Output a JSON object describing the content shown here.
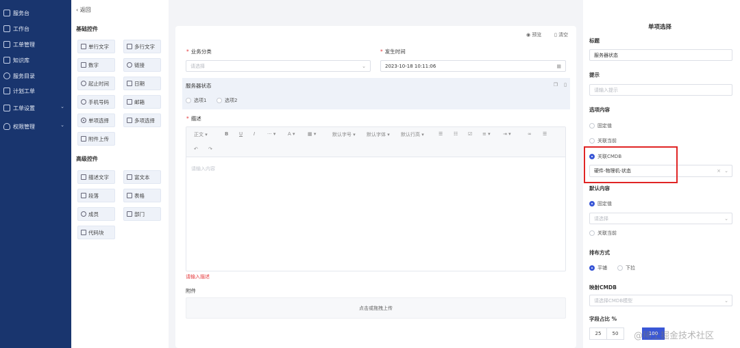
{
  "nav": {
    "items": [
      {
        "label": "服务台"
      },
      {
        "label": "工作台"
      },
      {
        "label": "工单管理"
      },
      {
        "label": "知识库"
      },
      {
        "label": "服务目录"
      },
      {
        "label": "计划工单"
      },
      {
        "label": "工单设置"
      },
      {
        "label": "权限管理"
      }
    ]
  },
  "left": {
    "back": "返回",
    "basic_title": "基础控件",
    "basic": [
      "单行文字",
      "多行文字",
      "数字",
      "链接",
      "起止时间",
      "日期",
      "手机号码",
      "邮箱",
      "单项选择",
      "多项选择",
      "附件上传"
    ],
    "adv_title": "高级控件",
    "adv": [
      "描述文字",
      "富文本",
      "段落",
      "表格",
      "成员",
      "部门",
      "代码块"
    ]
  },
  "canvas": {
    "preview": "预览",
    "clear": "清空",
    "cat_label": "业务分类",
    "cat_placeholder": "请选择",
    "time_label": "发生时间",
    "time_value": "2023-10-18 10:11:06",
    "server_label": "服务器状态",
    "opt1": "选项1",
    "opt2": "选项2",
    "desc_label": "描述",
    "toolbar": {
      "text": "正文",
      "font_size": "默认字号",
      "font_family": "默认字体",
      "line_height": "默认行高"
    },
    "editor_placeholder": "请输入内容",
    "error": "请输入描述",
    "attach_label": "附件",
    "upload": "点击或拖拽上传"
  },
  "right": {
    "title": "单项选择",
    "f_title": "标题",
    "f_title_value": "服务器状态",
    "f_hint": "提示",
    "f_hint_placeholder": "请输入提示",
    "opt_content": "选项内容",
    "opt_fixed": "固定值",
    "opt_current": "关联当前",
    "opt_cmdb": "关联CMDB",
    "cmdb_value": "硬件-物理机-状态",
    "default_title": "默认内容",
    "def_fixed": "固定值",
    "def_placeholder": "请选择",
    "def_current": "关联当前",
    "layout_title": "排布方式",
    "layout_h": "平铺",
    "layout_v": "下拉",
    "map_title": "映射CMDB",
    "map_placeholder": "请选择CMDB模型",
    "ratio_title": "字段占比 %",
    "ratios": [
      "25",
      "50",
      "100"
    ]
  },
  "watermark": "@稀土掘金技术社区",
  "colors": {
    "sidebar": "#19356e",
    "accent": "#3a57d6",
    "highlight": "#e02424"
  }
}
